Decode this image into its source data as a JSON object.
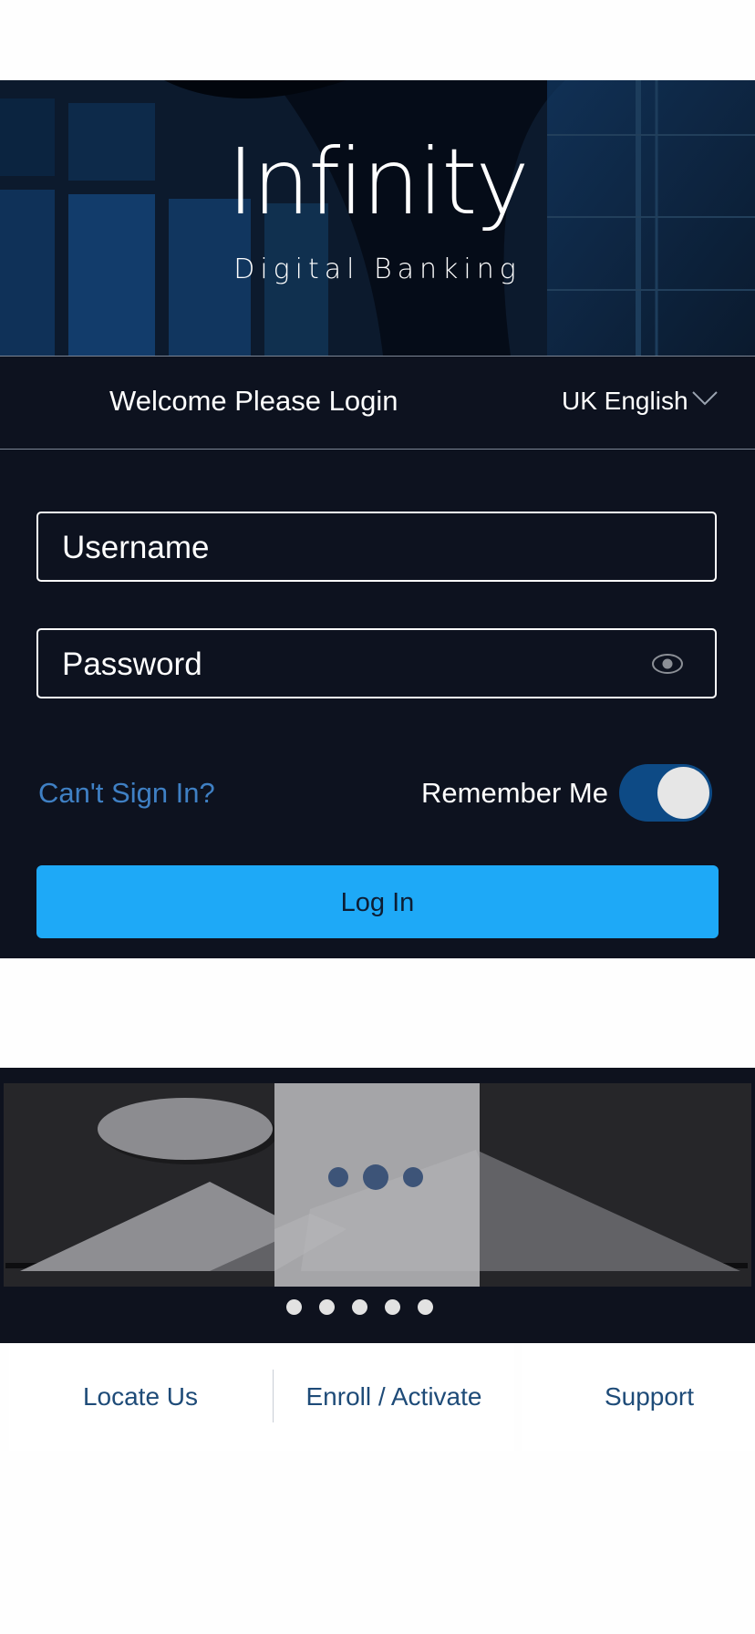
{
  "brand": {
    "name": "Infinity",
    "tagline": "Digital Banking"
  },
  "header": {
    "welcome": "Welcome Please Login",
    "language": "UK English"
  },
  "form": {
    "username_placeholder": "Username",
    "password_placeholder": "Password",
    "cant_sign_in": "Can't Sign In?",
    "remember_me": "Remember Me",
    "remember_me_on": true,
    "login_label": "Log In"
  },
  "carousel": {
    "slide_count": 5
  },
  "footer_links": [
    {
      "label": "Locate Us"
    },
    {
      "label": "Enroll / Activate"
    },
    {
      "label": "Support"
    }
  ],
  "colors": {
    "panel": "#0d121f",
    "accent": "#1ea9f7",
    "link": "#3f80c4",
    "toggle": "#0d4a85"
  },
  "icons": [
    "chevron-down-icon",
    "eye-icon",
    "image-placeholder-icon",
    "loading-dots-icon"
  ]
}
